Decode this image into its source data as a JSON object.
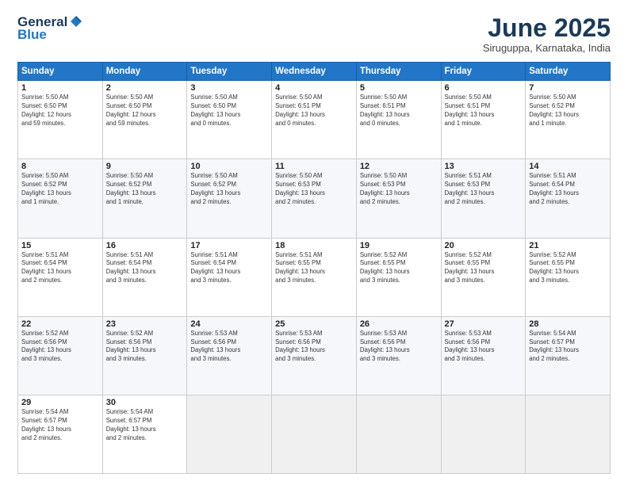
{
  "header": {
    "logo_general": "General",
    "logo_blue": "Blue",
    "month_title": "June 2025",
    "subtitle": "Siruguppa, Karnataka, India"
  },
  "weekdays": [
    "Sunday",
    "Monday",
    "Tuesday",
    "Wednesday",
    "Thursday",
    "Friday",
    "Saturday"
  ],
  "weeks": [
    [
      {
        "day": "1",
        "info": "Sunrise: 5:50 AM\nSunset: 6:50 PM\nDaylight: 12 hours\nand 59 minutes."
      },
      {
        "day": "2",
        "info": "Sunrise: 5:50 AM\nSunset: 6:50 PM\nDaylight: 12 hours\nand 59 minutes."
      },
      {
        "day": "3",
        "info": "Sunrise: 5:50 AM\nSunset: 6:50 PM\nDaylight: 13 hours\nand 0 minutes."
      },
      {
        "day": "4",
        "info": "Sunrise: 5:50 AM\nSunset: 6:51 PM\nDaylight: 13 hours\nand 0 minutes."
      },
      {
        "day": "5",
        "info": "Sunrise: 5:50 AM\nSunset: 6:51 PM\nDaylight: 13 hours\nand 0 minutes."
      },
      {
        "day": "6",
        "info": "Sunrise: 5:50 AM\nSunset: 6:51 PM\nDaylight: 13 hours\nand 1 minute."
      },
      {
        "day": "7",
        "info": "Sunrise: 5:50 AM\nSunset: 6:52 PM\nDaylight: 13 hours\nand 1 minute."
      }
    ],
    [
      {
        "day": "8",
        "info": "Sunrise: 5:50 AM\nSunset: 6:52 PM\nDaylight: 13 hours\nand 1 minute."
      },
      {
        "day": "9",
        "info": "Sunrise: 5:50 AM\nSunset: 6:52 PM\nDaylight: 13 hours\nand 1 minute."
      },
      {
        "day": "10",
        "info": "Sunrise: 5:50 AM\nSunset: 6:52 PM\nDaylight: 13 hours\nand 2 minutes."
      },
      {
        "day": "11",
        "info": "Sunrise: 5:50 AM\nSunset: 6:53 PM\nDaylight: 13 hours\nand 2 minutes."
      },
      {
        "day": "12",
        "info": "Sunrise: 5:50 AM\nSunset: 6:53 PM\nDaylight: 13 hours\nand 2 minutes."
      },
      {
        "day": "13",
        "info": "Sunrise: 5:51 AM\nSunset: 6:53 PM\nDaylight: 13 hours\nand 2 minutes."
      },
      {
        "day": "14",
        "info": "Sunrise: 5:51 AM\nSunset: 6:54 PM\nDaylight: 13 hours\nand 2 minutes."
      }
    ],
    [
      {
        "day": "15",
        "info": "Sunrise: 5:51 AM\nSunset: 6:54 PM\nDaylight: 13 hours\nand 2 minutes."
      },
      {
        "day": "16",
        "info": "Sunrise: 5:51 AM\nSunset: 6:54 PM\nDaylight: 13 hours\nand 3 minutes."
      },
      {
        "day": "17",
        "info": "Sunrise: 5:51 AM\nSunset: 6:54 PM\nDaylight: 13 hours\nand 3 minutes."
      },
      {
        "day": "18",
        "info": "Sunrise: 5:51 AM\nSunset: 6:55 PM\nDaylight: 13 hours\nand 3 minutes."
      },
      {
        "day": "19",
        "info": "Sunrise: 5:52 AM\nSunset: 6:55 PM\nDaylight: 13 hours\nand 3 minutes."
      },
      {
        "day": "20",
        "info": "Sunrise: 5:52 AM\nSunset: 6:55 PM\nDaylight: 13 hours\nand 3 minutes."
      },
      {
        "day": "21",
        "info": "Sunrise: 5:52 AM\nSunset: 6:55 PM\nDaylight: 13 hours\nand 3 minutes."
      }
    ],
    [
      {
        "day": "22",
        "info": "Sunrise: 5:52 AM\nSunset: 6:56 PM\nDaylight: 13 hours\nand 3 minutes."
      },
      {
        "day": "23",
        "info": "Sunrise: 5:52 AM\nSunset: 6:56 PM\nDaylight: 13 hours\nand 3 minutes."
      },
      {
        "day": "24",
        "info": "Sunrise: 5:53 AM\nSunset: 6:56 PM\nDaylight: 13 hours\nand 3 minutes."
      },
      {
        "day": "25",
        "info": "Sunrise: 5:53 AM\nSunset: 6:56 PM\nDaylight: 13 hours\nand 3 minutes."
      },
      {
        "day": "26",
        "info": "Sunrise: 5:53 AM\nSunset: 6:56 PM\nDaylight: 13 hours\nand 3 minutes."
      },
      {
        "day": "27",
        "info": "Sunrise: 5:53 AM\nSunset: 6:56 PM\nDaylight: 13 hours\nand 3 minutes."
      },
      {
        "day": "28",
        "info": "Sunrise: 5:54 AM\nSunset: 6:57 PM\nDaylight: 13 hours\nand 2 minutes."
      }
    ],
    [
      {
        "day": "29",
        "info": "Sunrise: 5:54 AM\nSunset: 6:57 PM\nDaylight: 13 hours\nand 2 minutes."
      },
      {
        "day": "30",
        "info": "Sunrise: 5:54 AM\nSunset: 6:57 PM\nDaylight: 13 hours\nand 2 minutes."
      },
      {
        "day": "",
        "info": ""
      },
      {
        "day": "",
        "info": ""
      },
      {
        "day": "",
        "info": ""
      },
      {
        "day": "",
        "info": ""
      },
      {
        "day": "",
        "info": ""
      }
    ]
  ]
}
